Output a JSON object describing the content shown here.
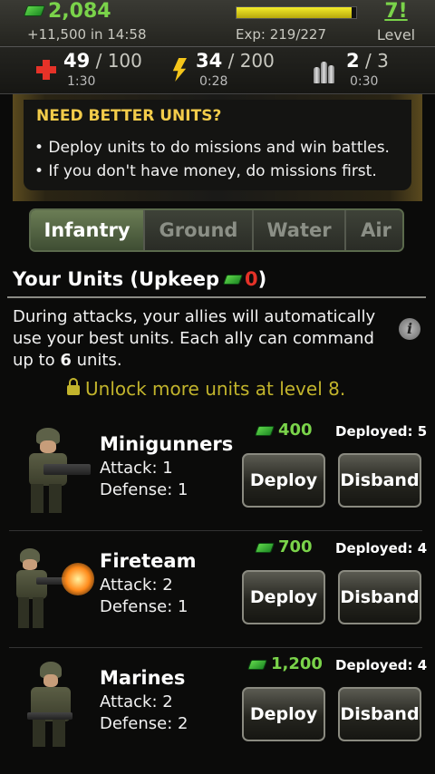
{
  "header": {
    "cash": "2,084",
    "income": "+11,500 in 14:58",
    "exp_label": "Exp: 219/227",
    "exp_progress": 0.965,
    "level": "7!",
    "level_label": "Level"
  },
  "stats": {
    "health": {
      "current": "49",
      "max": "100",
      "timer": "1:30"
    },
    "energy": {
      "current": "34",
      "max": "200",
      "timer": "0:28"
    },
    "ammo": {
      "current": "2",
      "max": "3",
      "timer": "0:30"
    }
  },
  "tip": {
    "title": "NEED BETTER UNITS?",
    "lines": [
      "• Deploy units to do missions and win battles.",
      "• If you don't have money, do missions first."
    ]
  },
  "tabs": [
    {
      "label": "Infantry",
      "active": true
    },
    {
      "label": "Ground",
      "active": false
    },
    {
      "label": "Water",
      "active": false
    },
    {
      "label": "Air",
      "active": false
    }
  ],
  "section": {
    "title_prefix": "Your Units (Upkeep",
    "upkeep": "0",
    "title_suffix": ")",
    "desc_before": "During attacks, your allies will automatically use your best units. Each ally can command up to ",
    "desc_count": "6",
    "desc_after": " units.",
    "unlock": "Unlock more units at level 8."
  },
  "units": [
    {
      "name": "Minigunners",
      "attack": "Attack: 1",
      "defense": "Defense: 1",
      "cost": "400",
      "deployed": "Deployed: 5",
      "deploy_label": "Deploy",
      "disband_label": "Disband"
    },
    {
      "name": "Fireteam",
      "attack": "Attack: 2",
      "defense": "Defense: 1",
      "cost": "700",
      "deployed": "Deployed: 4",
      "deploy_label": "Deploy",
      "disband_label": "Disband"
    },
    {
      "name": "Marines",
      "attack": "Attack: 2",
      "defense": "Defense: 2",
      "cost": "1,200",
      "deployed": "Deployed: 4",
      "deploy_label": "Deploy",
      "disband_label": "Disband"
    }
  ],
  "colors": {
    "cash_green": "#7ad34a",
    "upkeep_red": "#e53228",
    "tip_title": "#f3cc4a",
    "unlock_gold": "#c2b42c"
  },
  "icons": [
    "cash-icon",
    "health-cross-icon",
    "energy-bolt-icon",
    "ammo-icon",
    "info-icon",
    "lock-icon"
  ]
}
